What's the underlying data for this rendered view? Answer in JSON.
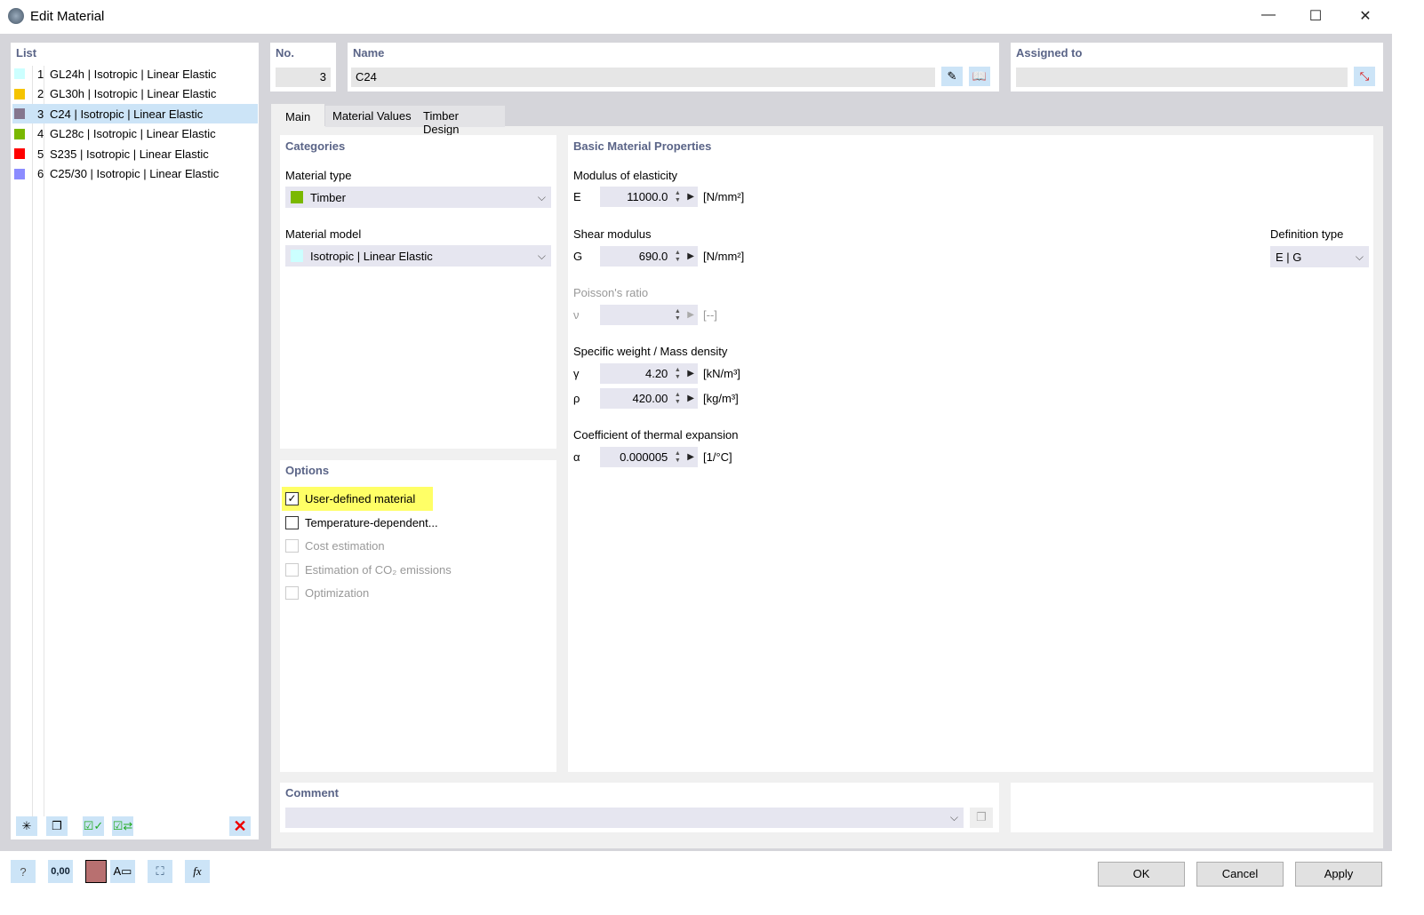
{
  "window": {
    "title": "Edit Material",
    "minimize": "—",
    "maximize": "☐",
    "close": "✕"
  },
  "list": {
    "header": "List",
    "items": [
      {
        "no": "1",
        "label": "GL24h | Isotropic | Linear Elastic",
        "color": "#ccffff"
      },
      {
        "no": "2",
        "label": "GL30h | Isotropic | Linear Elastic",
        "color": "#f5c400"
      },
      {
        "no": "3",
        "label": "C24 | Isotropic | Linear Elastic",
        "color": "#84768e",
        "selected": true
      },
      {
        "no": "4",
        "label": "GL28c | Isotropic | Linear Elastic",
        "color": "#7ab800"
      },
      {
        "no": "5",
        "label": "S235 | Isotropic | Linear Elastic",
        "color": "#ff0000"
      },
      {
        "no": "6",
        "label": "C25/30 | Isotropic | Linear Elastic",
        "color": "#8c8cff"
      }
    ]
  },
  "header": {
    "no_label": "No.",
    "no_value": "3",
    "name_label": "Name",
    "name_value": "C24",
    "assigned_label": "Assigned to",
    "assigned_value": ""
  },
  "tabs": [
    "Main",
    "Material Values",
    "Timber Design"
  ],
  "categories": {
    "header": "Categories",
    "material_type_label": "Material type",
    "material_type": "Timber",
    "material_type_color": "#7ab800",
    "material_model_label": "Material model",
    "material_model": "Isotropic | Linear Elastic",
    "material_model_color": "#ccffff"
  },
  "options": {
    "header": "Options",
    "items": [
      {
        "label": "User-defined material",
        "checked": true,
        "enabled": true,
        "highlight": "#ffff66"
      },
      {
        "label": "Temperature-dependent...",
        "checked": false,
        "enabled": true
      },
      {
        "label": "Cost estimation",
        "checked": false,
        "enabled": false
      },
      {
        "label": "Estimation of CO₂ emissions",
        "checked": false,
        "enabled": false
      },
      {
        "label": "Optimization",
        "checked": false,
        "enabled": false
      }
    ]
  },
  "props": {
    "header": "Basic Material Properties",
    "e_section": "Modulus of elasticity",
    "e_sym": "E",
    "e_val": "11000.0",
    "e_unit": "[N/mm²]",
    "g_section": "Shear modulus",
    "g_sym": "G",
    "g_val": "690.0",
    "g_unit": "[N/mm²]",
    "nu_section": "Poisson's ratio",
    "nu_sym": "ν",
    "nu_val": "",
    "nu_unit": "[--]",
    "w_section": "Specific weight / Mass density",
    "gamma_sym": "γ",
    "gamma_val": "4.20",
    "gamma_unit": "[kN/m³]",
    "rho_sym": "ρ",
    "rho_val": "420.00",
    "rho_unit": "[kg/m³]",
    "a_section": "Coefficient of thermal expansion",
    "a_sym": "α",
    "a_val": "0.000005",
    "a_unit": "[1/°C]",
    "def_type_label": "Definition type",
    "def_type": "E | G"
  },
  "comment": {
    "header": "Comment",
    "value": ""
  },
  "buttons": {
    "ok": "OK",
    "cancel": "Cancel",
    "apply": "Apply"
  },
  "footer_icons": {
    "units_text": "0,00",
    "color_swatch": "#b87070"
  }
}
